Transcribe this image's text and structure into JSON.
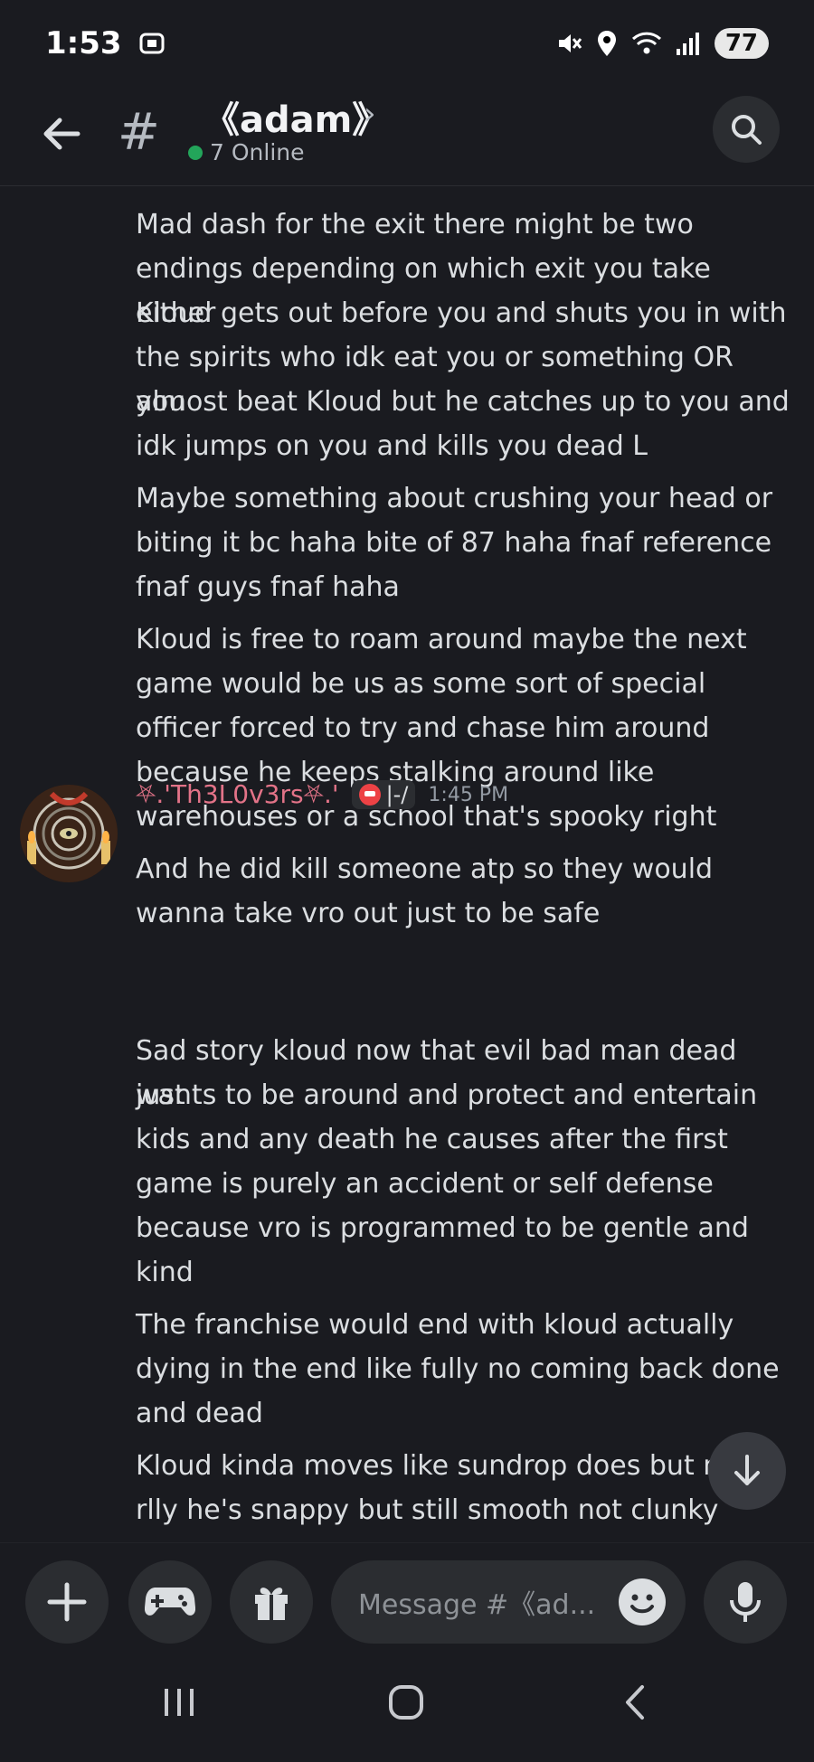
{
  "status_bar": {
    "time": "1:53",
    "battery": "77"
  },
  "header": {
    "channel_name": "《adam》",
    "online_count": "7 Online",
    "hash_symbol": "#"
  },
  "messages_top": [
    "Mad dash for the exit there might be two",
    "endings depending on which exit you take either",
    "Kloud gets out before you and shuts you in with",
    "the spirits who idk eat you or something OR you",
    "almost beat Kloud but he catches up to you and",
    "idk jumps on you and kills you dead L",
    "Maybe something about crushing your head or",
    "biting it bc haha bite of 87 haha fnaf reference",
    "fnaf guys fnaf haha",
    "Kloud is free to roam around maybe the next",
    "game would be us as some sort of special",
    "officer forced to try and chase him around",
    "because he keeps stalking around like",
    "warehouses or a school that's spooky right",
    "And he did kill someone atp so they would",
    "wanna take vro out just to be safe"
  ],
  "author": {
    "name": "⛧.'Th3L0v3rs⛧.'",
    "role_tag": "|-/",
    "timestamp": "1:45 PM"
  },
  "messages_bottom": [
    "Sad story kloud now that evil bad man dead just",
    "wants to be around and protect and entertain",
    "kids and any death he causes after the first",
    "game is purely an accident or self defense",
    "because vro is programmed to be gentle and",
    "kind",
    "The franchise would end with kloud actually",
    "dying in the end like fully no coming back done",
    "and dead",
    "Kloud kinda moves like sundrop does but n",
    "rlly he's snappy but still smooth not clunky"
  ],
  "composer": {
    "placeholder": "Message #《ad..."
  },
  "colors": {
    "background": "#1a1b20",
    "author_name": "#e37388",
    "online_dot": "#23a55a"
  }
}
